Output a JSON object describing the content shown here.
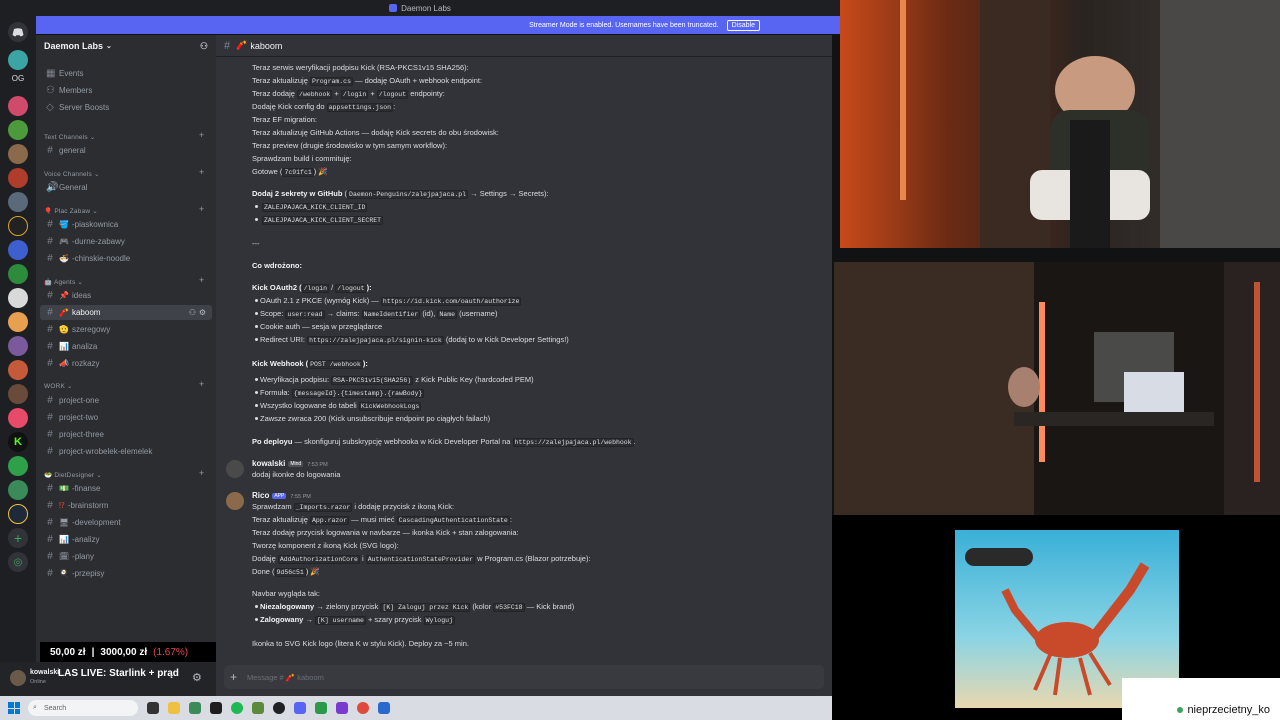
{
  "window": {
    "title": "Daemon Labs"
  },
  "banner": {
    "text": "Streamer Mode is enabled. Usernames have been truncated.",
    "button": "Disable"
  },
  "server": {
    "name": "Daemon Labs"
  },
  "rail": {
    "og_label": "OG"
  },
  "sidebar": {
    "top_items": [
      {
        "label": "Events",
        "icon": "calendar-icon"
      },
      {
        "label": "Members",
        "icon": "members-icon"
      },
      {
        "label": "Server Boosts",
        "icon": "boost-icon"
      }
    ],
    "categories": [
      {
        "name": "Text Channels",
        "channels": [
          "general"
        ]
      },
      {
        "name": "Voice Channels",
        "channels": [
          "General"
        ]
      },
      {
        "name": "Plac Zabaw",
        "channels": [
          "-piaskownica",
          "-durne-zabawy",
          "-chinskie-noodle"
        ]
      },
      {
        "name": "Agents",
        "channels": [
          "ideas",
          "kaboom",
          "szeregowy",
          "analiza",
          "rozkazy"
        ]
      },
      {
        "name": "WORK",
        "channels": [
          "project-one",
          "project-two",
          "project-three",
          "project-wrobelek-elemelek"
        ]
      },
      {
        "name": "DietDesigner",
        "channels": [
          "-finanse",
          "-brainstorm",
          "-development",
          "-analizy",
          "-plany",
          "-przepisy"
        ]
      }
    ],
    "active_channel": "kaboom"
  },
  "user_panel": {
    "name": "kowalski",
    "status": "Online"
  },
  "overlay": {
    "donation_current": "50,00 zł",
    "donation_goal": "3000,00 zł",
    "donation_pct": "(1.67%)",
    "stream_title": "LAS LIVE: Starlink + prąd",
    "viewer_name": "nieprzecietny_ko"
  },
  "chat": {
    "channel": "kaboom",
    "composer_placeholder": "Message # 🧨 kaboom",
    "lines_a": [
      "Teraz serwis weryfikacji podpisu Kick (RSA-PKCS1v15 SHA256):",
      "Teraz aktualizuję",
      "— dodaję OAuth + webhook endpoint:",
      "Teraz dodaję",
      "endpointy:",
      "Dodaję Kick config do",
      "Teraz EF migration:",
      "Teraz aktualizuję GitHub Actions — dodaję Kick secrets do obu środowisk:",
      "Teraz preview (drugie środowisko w tym samym workflow):",
      "Sprawdzam build i commituję:",
      "Gotowe ("
    ],
    "codes_a": [
      "Program.cs",
      "/webhook",
      "/login",
      "/logout",
      "appsettings.json",
      "7c91fc1"
    ],
    "secrets": {
      "title": "Dodaj 2 sekrety w GitHub",
      "repo": "Daemon-Penguins/zalejpajaca.pl",
      "path": "→ Settings → Secrets):",
      "items": [
        "ZALEJPAJACA_KICK_CLIENT_ID",
        "ZALEJPAJACA_KICK_CLIENT_SECRET"
      ]
    },
    "separator": "---",
    "deployed_title": "Co wdrożono:",
    "oauth": {
      "title": "Kick OAuth2 (",
      "codes": [
        "/login",
        "/logout"
      ],
      "items": [
        {
          "pre": "OAuth 2.1 z PKCE (wymóg Kick) —",
          "code": "https://id.kick.com/oauth/authorize",
          "post": ""
        },
        {
          "pre": "Scope:",
          "code": "user:read",
          "post": "→ claims:"
        },
        {
          "pre": "Cookie auth — sesja w przeglądarce",
          "code": "",
          "post": ""
        },
        {
          "pre": "Redirect URI:",
          "code": "https://zalejpajaca.pl/signin-kick",
          "post": "(dodaj to w Kick Developer Settings!)"
        }
      ],
      "claims": [
        "NameIdentifier",
        "(id),",
        "Name",
        "(username)"
      ]
    },
    "webhook": {
      "title": "Kick Webhook (",
      "code": "POST /webhook",
      "items": [
        {
          "pre": "Weryfikacja podpisu:",
          "code": "RSA-PKCS1v15(SHA256)",
          "post": "z Kick Public Key (hardcoded PEM)"
        },
        {
          "pre": "Formuła:",
          "code": "{messageId}.{timestamp}.{rawBody}",
          "post": ""
        },
        {
          "pre": "Wszystko logowane do tabeli",
          "code": "KickWebhookLogs",
          "post": ""
        },
        {
          "pre": "Zawsze zwraca 200 (Kick unsubscribuje endpoint po ciągłych failach)",
          "code": "",
          "post": ""
        }
      ]
    },
    "after_deploy": {
      "title": "Po deployu",
      "text": "— skonfiguruj subskrypcję webhooka w Kick Developer Portal na",
      "code": "https://zalejpajaca.pl/webhook",
      "end": "."
    },
    "msg2": {
      "author": "kowalski",
      "tag": "Mind",
      "time": "7:53 PM",
      "text": "dodaj ikonke do logowania"
    },
    "msg3": {
      "author": "Rico",
      "tag": "APP",
      "time": "7:55 PM",
      "lines": [
        {
          "pre": "Sprawdzam",
          "code": "_Imports.razor",
          "post": "i dodaję przycisk z ikoną Kick:"
        },
        {
          "pre": "Teraz aktualizuję",
          "code": "App.razor",
          "post": "— musi mieć",
          "code2": "CascadingAuthenticationState",
          "post2": ":"
        },
        {
          "pre": "Teraz dodaję przycisk logowania w navbarze — ikonka Kick + stan zalogowania:",
          "code": "",
          "post": ""
        },
        {
          "pre": "Tworzę komponent z ikoną Kick (SVG logo):",
          "code": "",
          "post": ""
        },
        {
          "pre": "Dodaję",
          "code": "AddAuthorizationCore",
          "post": "i",
          "code2": "AuthenticationStateProvider",
          "post2": "w Program.cs (Blazor potrzebuje):"
        },
        {
          "pre": "Done (",
          "code": "9d56c51",
          "post": ")"
        }
      ],
      "navbar_title": "Navbar wygląda tak:",
      "navbar_items": [
        {
          "bold": "Niezalogowany",
          "pre": "→ zielony przycisk",
          "code": "[K] Zaloguj przez Kick",
          "post": "(kolor",
          "code2": "#53FC18",
          "post2": "— Kick brand)"
        },
        {
          "bold": "Zalogowany",
          "pre": "→",
          "code": "[K] username",
          "post": "+ szary przycisk",
          "code2": "Wyloguj",
          "post2": ""
        }
      ],
      "footer": "Ikonka to SVG Kick logo (litera K w stylu Kick). Deploy za ~5 min."
    }
  },
  "taskbar": {
    "search_placeholder": "Search"
  },
  "colors": {
    "blurple": "#5865f2",
    "kick_green": "#53fc18",
    "link": "#00a8fc"
  }
}
